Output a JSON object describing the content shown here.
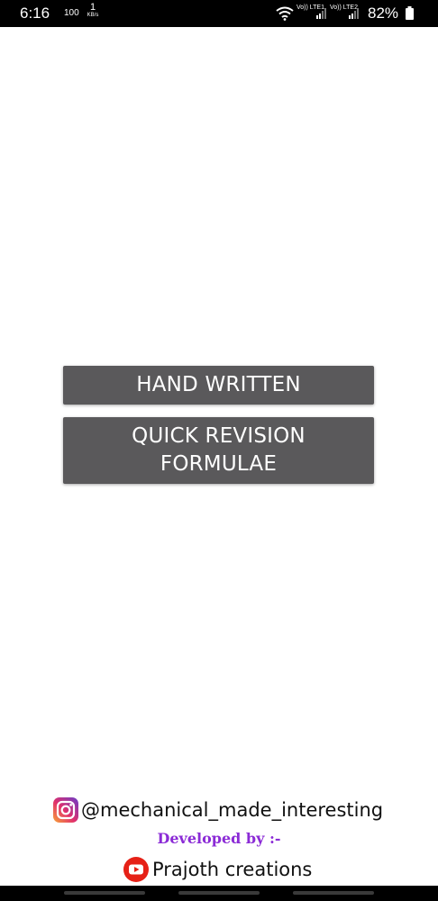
{
  "status_bar": {
    "time": "6:16",
    "small_indicator": "100",
    "speed_value": "1",
    "speed_unit": "KB/s",
    "sim1_label": "Vo)) LTE1",
    "sim2_label": "Vo)) LTE2",
    "battery": "82%",
    "icons": [
      "wifi-icon",
      "signal-icon",
      "battery-icon"
    ]
  },
  "buttons": {
    "hand_written": "HAND WRITTEN",
    "quick_revision": "QUICK REVISION FORMULAE"
  },
  "footer": {
    "instagram_handle": "@mechanical_made_interesting",
    "developed_by": "Developed by :-",
    "creator": "Prajoth creations"
  },
  "colors": {
    "button_bg": "#5a595b",
    "developed_by_text": "#8b2bd6",
    "youtube_red": "#e62117"
  }
}
